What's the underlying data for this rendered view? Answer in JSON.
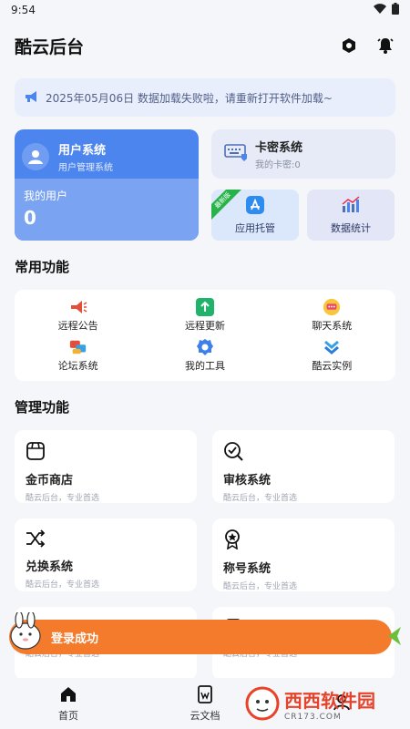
{
  "status": {
    "time": "9:54"
  },
  "app": {
    "title": "酷云后台"
  },
  "notice": {
    "text": "2025年05月06日  数据加载失败啦，请重新打开软件加载~"
  },
  "user_card": {
    "title": "用户系统",
    "subtitle": "用户管理系统",
    "my_users_label": "我的用户",
    "my_users_count": "0"
  },
  "card_sys": {
    "title": "卡密系统",
    "subtitle": "我的卡密:0"
  },
  "mini": {
    "app": "应用托管",
    "app_ribbon": "最新版",
    "stat": "数据统计"
  },
  "common": {
    "title": "常用功能",
    "items": [
      {
        "label": "远程公告",
        "icon": "megaphone-icon"
      },
      {
        "label": "远程更新",
        "icon": "upload-icon"
      },
      {
        "label": "聊天系统",
        "icon": "chat-bubble-icon"
      },
      {
        "label": "论坛系统",
        "icon": "forum-icon"
      },
      {
        "label": "我的工具",
        "icon": "gear-icon"
      },
      {
        "label": "酷云实例",
        "icon": "chevrons-down-icon"
      }
    ]
  },
  "manage": {
    "title": "管理功能",
    "items": [
      {
        "title": "金币商店",
        "subtitle": "酷云后台，专业首选",
        "icon": "store-icon"
      },
      {
        "title": "审核系统",
        "subtitle": "酷云后台，专业首选",
        "icon": "check-search-icon"
      },
      {
        "title": "兑换系统",
        "subtitle": "酷云后台，专业首选",
        "icon": "shuffle-icon"
      },
      {
        "title": "称号系统",
        "subtitle": "酷云后台，专业首选",
        "icon": "badge-icon"
      },
      {
        "title": "",
        "subtitle": "酷云后台，专业首选",
        "icon": "remote-icon"
      },
      {
        "title": "",
        "subtitle": "酷云后台，专业首选",
        "icon": "doc-icon"
      }
    ]
  },
  "toast": {
    "text": "登录成功"
  },
  "nav": {
    "tabs": [
      {
        "label": "首页"
      },
      {
        "label": "云文档"
      },
      {
        "label": ""
      }
    ]
  },
  "watermark": {
    "main": "西西软件园",
    "sub": "CR173.COM"
  },
  "colors": {
    "primary": "#4d85ee",
    "toast": "#f47a2c",
    "background": "#f4f6fa"
  }
}
